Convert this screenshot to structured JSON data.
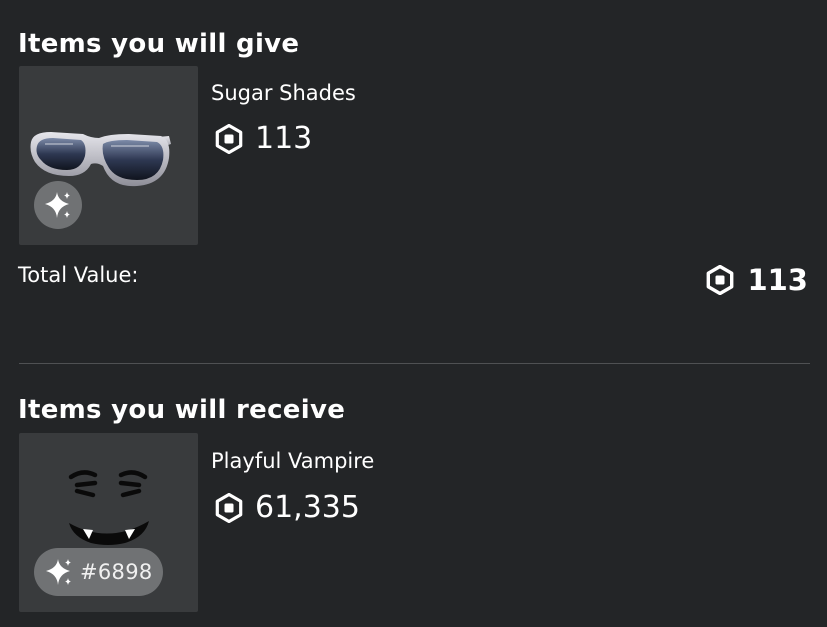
{
  "give": {
    "title": "Items you will give",
    "item": {
      "name": "Sugar Shades",
      "price": "113",
      "price_icon": "robux-icon",
      "badge_icon": "sparkle-icon"
    },
    "total_label": "Total Value:",
    "total_value": "113"
  },
  "receive": {
    "title": "Items you will receive",
    "item": {
      "name": "Playful Vampire",
      "price": "61,335",
      "price_icon": "robux-icon",
      "badge_icon": "sparkle-icon",
      "serial": "#6898"
    }
  },
  "colors": {
    "background": "#232527",
    "thumbnail_bg": "#393b3d",
    "badge_bg": "#707274",
    "divider": "#4f5153",
    "text": "#ffffff"
  }
}
